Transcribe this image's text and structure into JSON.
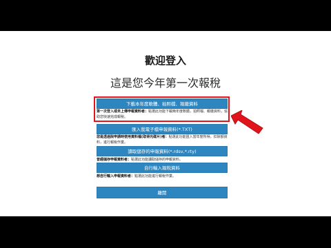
{
  "page": {
    "title": "歡迎登入",
    "subtitle": "這是您今年第一次報稅"
  },
  "options": [
    {
      "button": "下載本年度軟體、拍照檔、報繳資料",
      "desc_bold": "第一次登入或未上傳申報資料者：",
      "desc_text": "點選此功能下載簡年度軟體，拍照檔、報繳資料，協助您快速完成報稅。"
    },
    {
      "button": "匯入我電子檔申報資料(*.TXT)",
      "desc_bold": "您是透過院申請時使用資料檔(取得光碟片)者：",
      "desc_text": "點選此功能匯入當年度所得，扣除額資料，進行報稅作業。"
    },
    {
      "button": "讀取儲存的申報資料(*.rdsv,*.rty)",
      "desc_bold": "曾經儲存申報資料者：",
      "desc_text": "點選此功能讀取儲存的申報資料。"
    },
    {
      "button": "自行輸入報稅資料",
      "desc_bold": "想自行輸入申報資料者：",
      "desc_text": "點選此功能進行報稅作業。"
    }
  ],
  "footer": {
    "leave_button": "離開"
  },
  "colors": {
    "button_blue": "#2e86c1",
    "highlight_red": "#e0141b"
  }
}
